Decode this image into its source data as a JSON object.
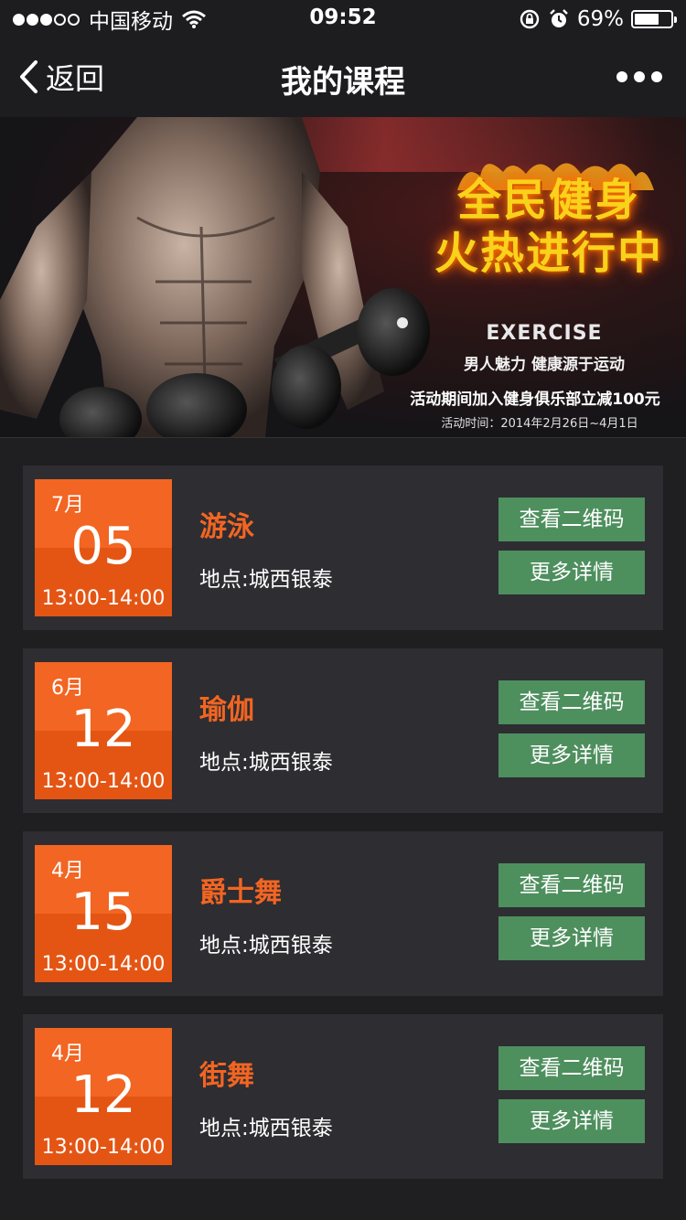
{
  "status_bar": {
    "carrier": "中国移动",
    "time": "09:52",
    "battery": "69%",
    "battery_level": 0.69
  },
  "nav": {
    "back_label": "返回",
    "title": "我的课程"
  },
  "banner": {
    "headline_line1": "全民健身",
    "headline_line2": "火热进行中",
    "exercise": "EXERCISE",
    "slogan": "男人魅力  健康源于运动",
    "promo": "活动期间加入健身俱乐部立减100元",
    "date": "活动时间：2014年2月26日~4月1日"
  },
  "courses": [
    {
      "month": "7月",
      "day": "05",
      "time": "13:00-14:00",
      "name": "游泳",
      "location": "地点:城西银泰",
      "qr_label": "查看二维码",
      "detail_label": "更多详情"
    },
    {
      "month": "6月",
      "day": "12",
      "time": "13:00-14:00",
      "name": "瑜伽",
      "location": "地点:城西银泰",
      "qr_label": "查看二维码",
      "detail_label": "更多详情"
    },
    {
      "month": "4月",
      "day": "15",
      "time": "13:00-14:00",
      "name": "爵士舞",
      "location": "地点:城西银泰",
      "qr_label": "查看二维码",
      "detail_label": "更多详情"
    },
    {
      "month": "4月",
      "day": "12",
      "time": "13:00-14:00",
      "name": "街舞",
      "location": "地点:城西银泰",
      "qr_label": "查看二维码",
      "detail_label": "更多详情"
    }
  ],
  "colors": {
    "accent_orange": "#f26522",
    "button_green": "#4e8f5e",
    "card_bg": "#2d2d32",
    "page_bg": "#1f1f22"
  }
}
